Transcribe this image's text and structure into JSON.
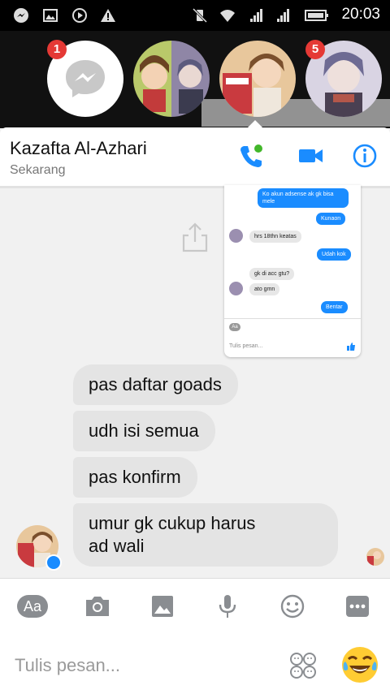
{
  "statusbar": {
    "time": "20:03",
    "left_icons": [
      "messenger-icon",
      "image-icon",
      "play-icon",
      "warning-icon"
    ],
    "right_icons": [
      "mute-vibrate-icon",
      "wifi-icon",
      "signal-icon",
      "signal-icon",
      "battery-icon"
    ]
  },
  "chat_heads": {
    "messenger_badge": "1",
    "last_badge": "5"
  },
  "header": {
    "name": "Kazafta Al-Azhari",
    "status": "Sekarang"
  },
  "shared_screenshot": {
    "messages": [
      {
        "side": "out",
        "text": "Ko akun adsense ak gk bisa mele"
      },
      {
        "side": "out",
        "text": "Kunaon"
      },
      {
        "side": "in",
        "text": "hrs 18thn keatas"
      },
      {
        "side": "out",
        "text": "Udah kok"
      },
      {
        "side": "in",
        "text": "gk di acc gtu?"
      },
      {
        "side": "in",
        "text": "ato gmn"
      },
      {
        "side": "out",
        "text": "Bentar"
      }
    ],
    "toolbar_aa": "Aa",
    "input_placeholder": "Tulis pesan..."
  },
  "messages": [
    {
      "text": "pas daftar goads"
    },
    {
      "text": "udh isi semua"
    },
    {
      "text": "pas konfirm"
    },
    {
      "text": "umur gk cukup harus\nad wali"
    }
  ],
  "composer": {
    "aa_label": "Aa",
    "placeholder": "Tulis pesan..."
  },
  "colors": {
    "accent": "#1a8cff",
    "bubble_in": "#e4e4e4",
    "badge": "#e53935"
  }
}
